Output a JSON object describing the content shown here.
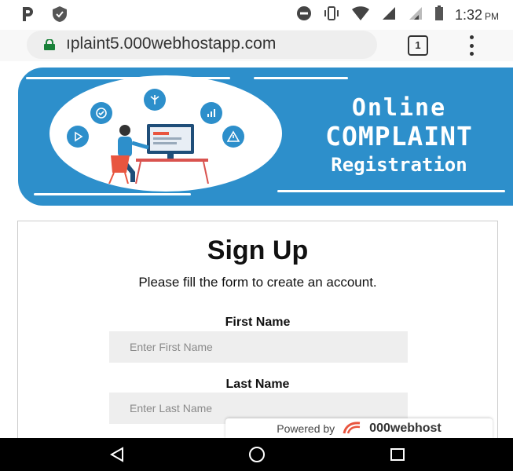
{
  "status_bar": {
    "time": "1:32",
    "ampm": "PM"
  },
  "browser": {
    "url": "ıplaint5.000webhostapp.com",
    "tab_count": "1"
  },
  "banner": {
    "line1": "Online",
    "line2": "COMPLAINT",
    "line3": "Registration"
  },
  "form": {
    "title": "Sign Up",
    "subtitle": "Please fill the form to create an account.",
    "first_name": {
      "label": "First Name",
      "placeholder": "Enter First Name",
      "value": ""
    },
    "last_name": {
      "label": "Last Name",
      "placeholder": "Enter Last Name",
      "value": ""
    }
  },
  "badge": {
    "prefix": "Powered by",
    "brand": "000webhost"
  },
  "colors": {
    "banner_blue": "#2d8fcb",
    "input_bg": "#eeeeee",
    "lock_green": "#188038",
    "brand_orange": "#e8553f"
  },
  "icons": [
    "p-icon",
    "vpn-shield-icon",
    "do-not-disturb-icon",
    "vibrate-icon",
    "wifi-icon",
    "signal-icon",
    "signal-weak-icon",
    "battery-icon",
    "lock-icon",
    "tab-count-icon",
    "overflow-menu-icon",
    "back-icon",
    "home-icon",
    "recents-icon"
  ]
}
